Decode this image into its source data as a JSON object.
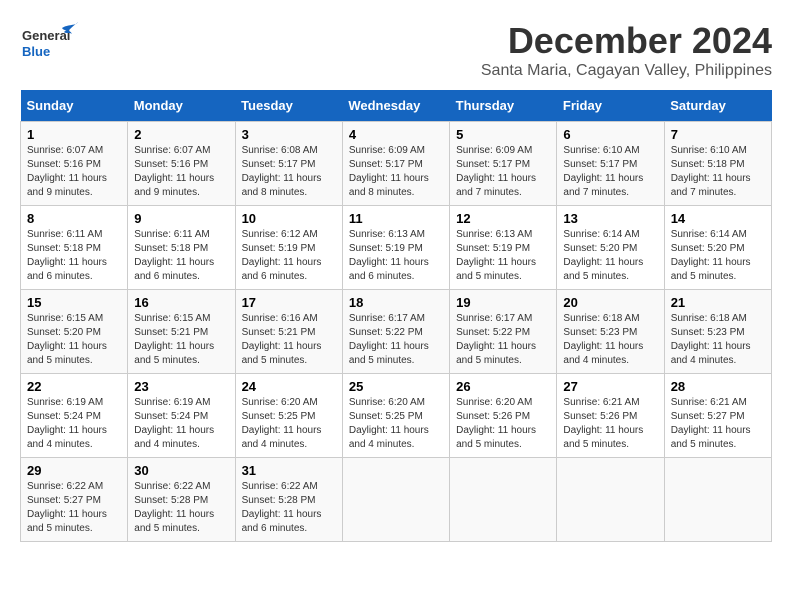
{
  "logo": {
    "part1": "General",
    "part2": "Blue"
  },
  "title": "December 2024",
  "subtitle": "Santa Maria, Cagayan Valley, Philippines",
  "days_of_week": [
    "Sunday",
    "Monday",
    "Tuesday",
    "Wednesday",
    "Thursday",
    "Friday",
    "Saturday"
  ],
  "weeks": [
    [
      {
        "day": "1",
        "info": "Sunrise: 6:07 AM\nSunset: 5:16 PM\nDaylight: 11 hours and 9 minutes."
      },
      {
        "day": "2",
        "info": "Sunrise: 6:07 AM\nSunset: 5:16 PM\nDaylight: 11 hours and 9 minutes."
      },
      {
        "day": "3",
        "info": "Sunrise: 6:08 AM\nSunset: 5:17 PM\nDaylight: 11 hours and 8 minutes."
      },
      {
        "day": "4",
        "info": "Sunrise: 6:09 AM\nSunset: 5:17 PM\nDaylight: 11 hours and 8 minutes."
      },
      {
        "day": "5",
        "info": "Sunrise: 6:09 AM\nSunset: 5:17 PM\nDaylight: 11 hours and 7 minutes."
      },
      {
        "day": "6",
        "info": "Sunrise: 6:10 AM\nSunset: 5:17 PM\nDaylight: 11 hours and 7 minutes."
      },
      {
        "day": "7",
        "info": "Sunrise: 6:10 AM\nSunset: 5:18 PM\nDaylight: 11 hours and 7 minutes."
      }
    ],
    [
      {
        "day": "8",
        "info": "Sunrise: 6:11 AM\nSunset: 5:18 PM\nDaylight: 11 hours and 6 minutes."
      },
      {
        "day": "9",
        "info": "Sunrise: 6:11 AM\nSunset: 5:18 PM\nDaylight: 11 hours and 6 minutes."
      },
      {
        "day": "10",
        "info": "Sunrise: 6:12 AM\nSunset: 5:19 PM\nDaylight: 11 hours and 6 minutes."
      },
      {
        "day": "11",
        "info": "Sunrise: 6:13 AM\nSunset: 5:19 PM\nDaylight: 11 hours and 6 minutes."
      },
      {
        "day": "12",
        "info": "Sunrise: 6:13 AM\nSunset: 5:19 PM\nDaylight: 11 hours and 5 minutes."
      },
      {
        "day": "13",
        "info": "Sunrise: 6:14 AM\nSunset: 5:20 PM\nDaylight: 11 hours and 5 minutes."
      },
      {
        "day": "14",
        "info": "Sunrise: 6:14 AM\nSunset: 5:20 PM\nDaylight: 11 hours and 5 minutes."
      }
    ],
    [
      {
        "day": "15",
        "info": "Sunrise: 6:15 AM\nSunset: 5:20 PM\nDaylight: 11 hours and 5 minutes."
      },
      {
        "day": "16",
        "info": "Sunrise: 6:15 AM\nSunset: 5:21 PM\nDaylight: 11 hours and 5 minutes."
      },
      {
        "day": "17",
        "info": "Sunrise: 6:16 AM\nSunset: 5:21 PM\nDaylight: 11 hours and 5 minutes."
      },
      {
        "day": "18",
        "info": "Sunrise: 6:17 AM\nSunset: 5:22 PM\nDaylight: 11 hours and 5 minutes."
      },
      {
        "day": "19",
        "info": "Sunrise: 6:17 AM\nSunset: 5:22 PM\nDaylight: 11 hours and 5 minutes."
      },
      {
        "day": "20",
        "info": "Sunrise: 6:18 AM\nSunset: 5:23 PM\nDaylight: 11 hours and 4 minutes."
      },
      {
        "day": "21",
        "info": "Sunrise: 6:18 AM\nSunset: 5:23 PM\nDaylight: 11 hours and 4 minutes."
      }
    ],
    [
      {
        "day": "22",
        "info": "Sunrise: 6:19 AM\nSunset: 5:24 PM\nDaylight: 11 hours and 4 minutes."
      },
      {
        "day": "23",
        "info": "Sunrise: 6:19 AM\nSunset: 5:24 PM\nDaylight: 11 hours and 4 minutes."
      },
      {
        "day": "24",
        "info": "Sunrise: 6:20 AM\nSunset: 5:25 PM\nDaylight: 11 hours and 4 minutes."
      },
      {
        "day": "25",
        "info": "Sunrise: 6:20 AM\nSunset: 5:25 PM\nDaylight: 11 hours and 4 minutes."
      },
      {
        "day": "26",
        "info": "Sunrise: 6:20 AM\nSunset: 5:26 PM\nDaylight: 11 hours and 5 minutes."
      },
      {
        "day": "27",
        "info": "Sunrise: 6:21 AM\nSunset: 5:26 PM\nDaylight: 11 hours and 5 minutes."
      },
      {
        "day": "28",
        "info": "Sunrise: 6:21 AM\nSunset: 5:27 PM\nDaylight: 11 hours and 5 minutes."
      }
    ],
    [
      {
        "day": "29",
        "info": "Sunrise: 6:22 AM\nSunset: 5:27 PM\nDaylight: 11 hours and 5 minutes."
      },
      {
        "day": "30",
        "info": "Sunrise: 6:22 AM\nSunset: 5:28 PM\nDaylight: 11 hours and 5 minutes."
      },
      {
        "day": "31",
        "info": "Sunrise: 6:22 AM\nSunset: 5:28 PM\nDaylight: 11 hours and 6 minutes."
      },
      null,
      null,
      null,
      null
    ]
  ]
}
